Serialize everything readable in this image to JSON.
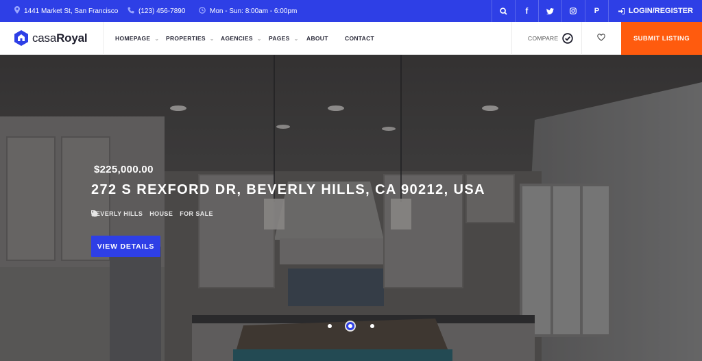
{
  "topbar": {
    "address": "1441 Market St, San Francisco",
    "phone": "(123) 456-7890",
    "hours": "Mon - Sun: 8:00am - 6:00pm",
    "login_label": "LOGIN/REGISTER",
    "social": [
      "search-icon",
      "facebook-icon",
      "twitter-icon",
      "instagram-icon",
      "pinterest-icon"
    ]
  },
  "brand": {
    "name_light": "casa",
    "name_bold": "Royal"
  },
  "nav": {
    "items": [
      {
        "label": "HOMEPAGE",
        "has_dropdown": true
      },
      {
        "label": "PROPERTIES",
        "has_dropdown": true
      },
      {
        "label": "AGENCIES",
        "has_dropdown": true
      },
      {
        "label": "PAGES",
        "has_dropdown": true
      },
      {
        "label": "ABOUT",
        "has_dropdown": false
      },
      {
        "label": "CONTACT",
        "has_dropdown": false
      }
    ],
    "compare_label": "COMPARE",
    "submit_label": "SUBMIT LISTING"
  },
  "hero": {
    "price": "$225,000.00",
    "address": "272 S REXFORD DR, BEVERLY HILLS, CA 90212, USA",
    "tags": [
      {
        "icon": "location-icon",
        "label": "BEVERLY HILLS"
      },
      {
        "icon": "home-icon",
        "label": "HOUSE"
      },
      {
        "icon": "tag-icon",
        "label": "FOR SALE"
      }
    ],
    "cta_label": "VIEW DETAILS",
    "slides_total": 3,
    "slide_active_index": 1
  },
  "colors": {
    "primary": "#2e3fe6",
    "accent": "#ff5b0e",
    "nav_text": "#2b2b3a"
  }
}
